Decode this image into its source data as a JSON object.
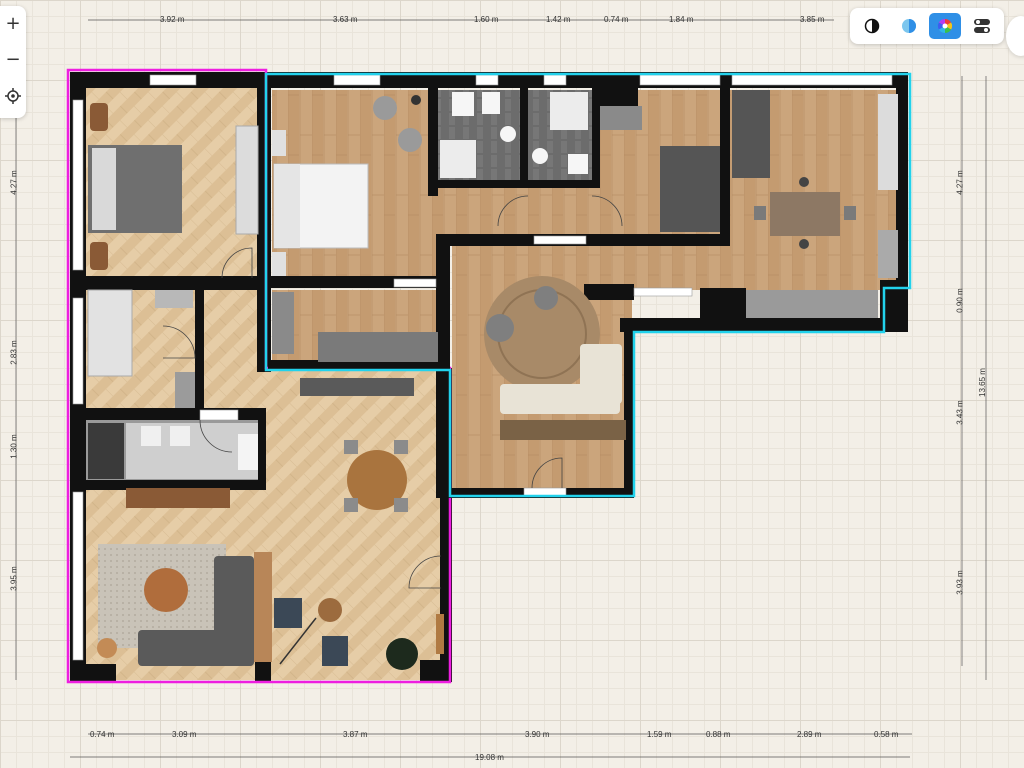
{
  "zoom_controls": {
    "zoom_in": "+",
    "zoom_out": "−"
  },
  "toolbar": {
    "buttons": [
      {
        "name": "contrast-icon",
        "active": false
      },
      {
        "name": "water-drop-icon",
        "active": false
      },
      {
        "name": "color-palette-icon",
        "active": true
      },
      {
        "name": "toggle-settings-icon",
        "active": false
      }
    ]
  },
  "dimensions": {
    "top": [
      "3.92 m",
      "3.63 m",
      "1.60 m",
      "1.42 m",
      "0.74 m",
      "1.84 m",
      "3.85 m"
    ],
    "bottom": [
      "0.74 m",
      "3.09 m",
      "3.87 m",
      "3.90 m",
      "1.59 m",
      "0.88 m",
      "2.89 m",
      "0.58 m"
    ],
    "bottom_total": "19.08 m",
    "left": [
      "4.27 m",
      "2.83 m",
      "1.30 m",
      "3.95 m"
    ],
    "right": [
      "4.27 m",
      "0.90 m",
      "3.43 m",
      "3.93 m"
    ],
    "right_total": "13.65 m"
  },
  "colors": {
    "left_unit_outline": "#ee1ee0",
    "right_unit_outline": "#22d2ec",
    "wood": "#cba57c",
    "herringbone": "#e3c9a2",
    "tile": "#6e6e6e",
    "wall": "#111111",
    "accent": "#2f8fe6"
  }
}
